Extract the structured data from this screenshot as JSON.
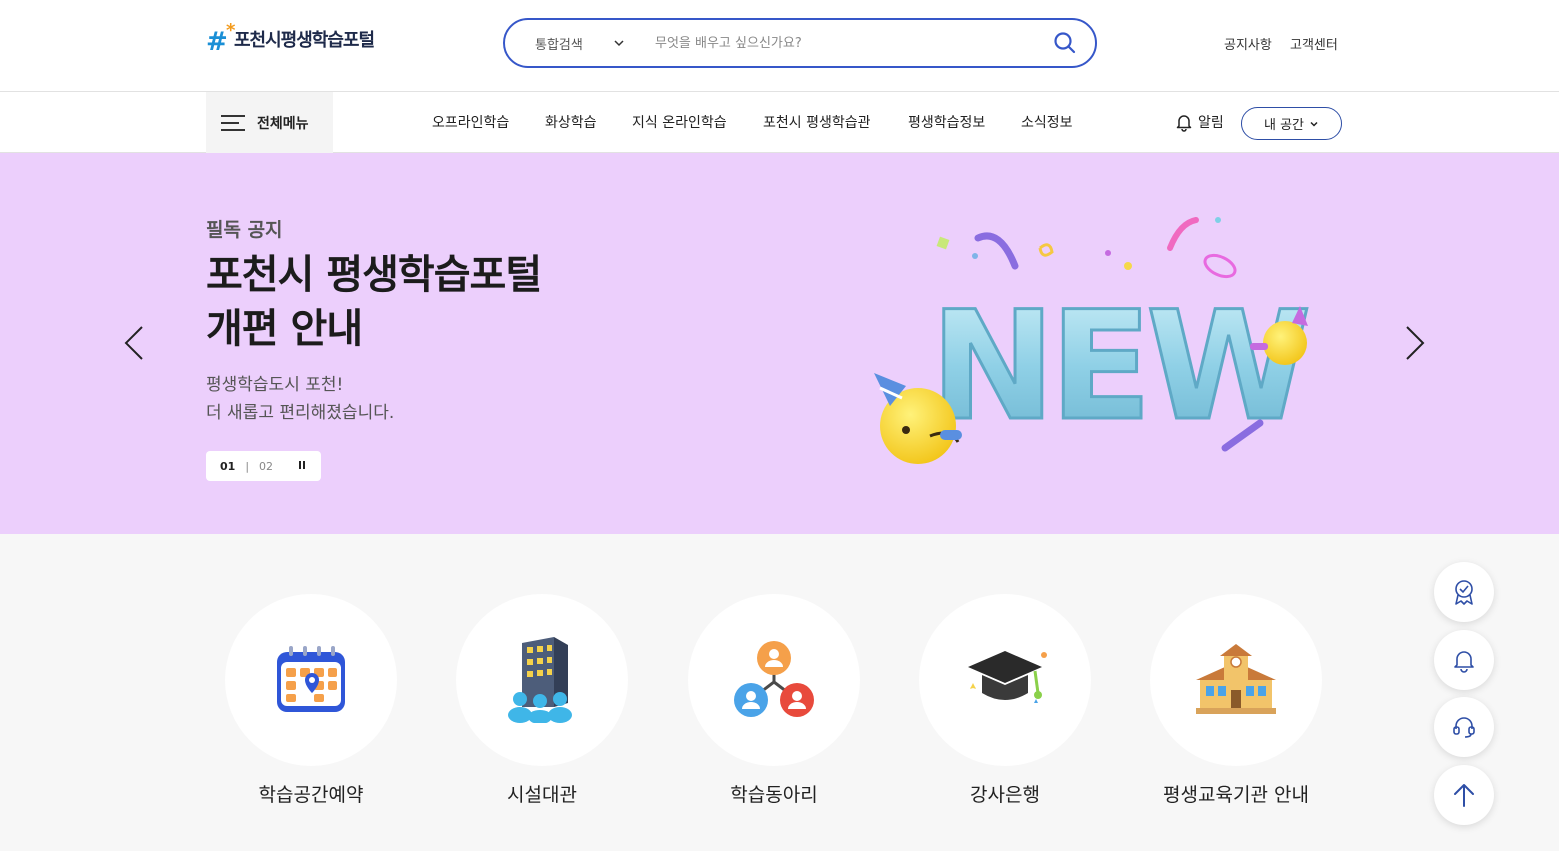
{
  "header": {
    "logo_text": "포천시평생학습포털",
    "search_category": "통합검색",
    "search_placeholder": "무엇을 배우고 싶으신가요?",
    "util_links": [
      "공지사항",
      "고객센터"
    ]
  },
  "nav": {
    "all_menu": "전체메뉴",
    "items": [
      "오프라인학습",
      "화상학습",
      "지식 온라인학습",
      "포천시 평생학습관",
      "평생학습정보",
      "소식정보"
    ],
    "alarm": "알림",
    "my_space": "내 공간"
  },
  "hero": {
    "eyebrow": "필독 공지",
    "title_line1": "포천시 평생학습포털",
    "title_line2": "개편 안내",
    "desc_line1": "평생학습도시 포천!",
    "desc_line2": "더 새롭고 편리해졌습니다.",
    "pager_current": "01",
    "pager_total": "02",
    "banner_word": "NEW",
    "bg_color": "#eccffc"
  },
  "quick_menu": [
    {
      "label": "학습공간예약",
      "icon": "calendar-icon"
    },
    {
      "label": "시설대관",
      "icon": "building-icon"
    },
    {
      "label": "학습동아리",
      "icon": "group-icon"
    },
    {
      "label": "강사은행",
      "icon": "graduation-cap-icon"
    },
    {
      "label": "평생교육기관 안내",
      "icon": "school-icon"
    }
  ],
  "floating_buttons": [
    "certificate-icon",
    "bell-icon",
    "headset-icon",
    "arrow-up-icon"
  ],
  "colors": {
    "accent": "#3657c9",
    "logo_blue": "#1a8fd6",
    "logo_orange": "#f39a1c"
  }
}
